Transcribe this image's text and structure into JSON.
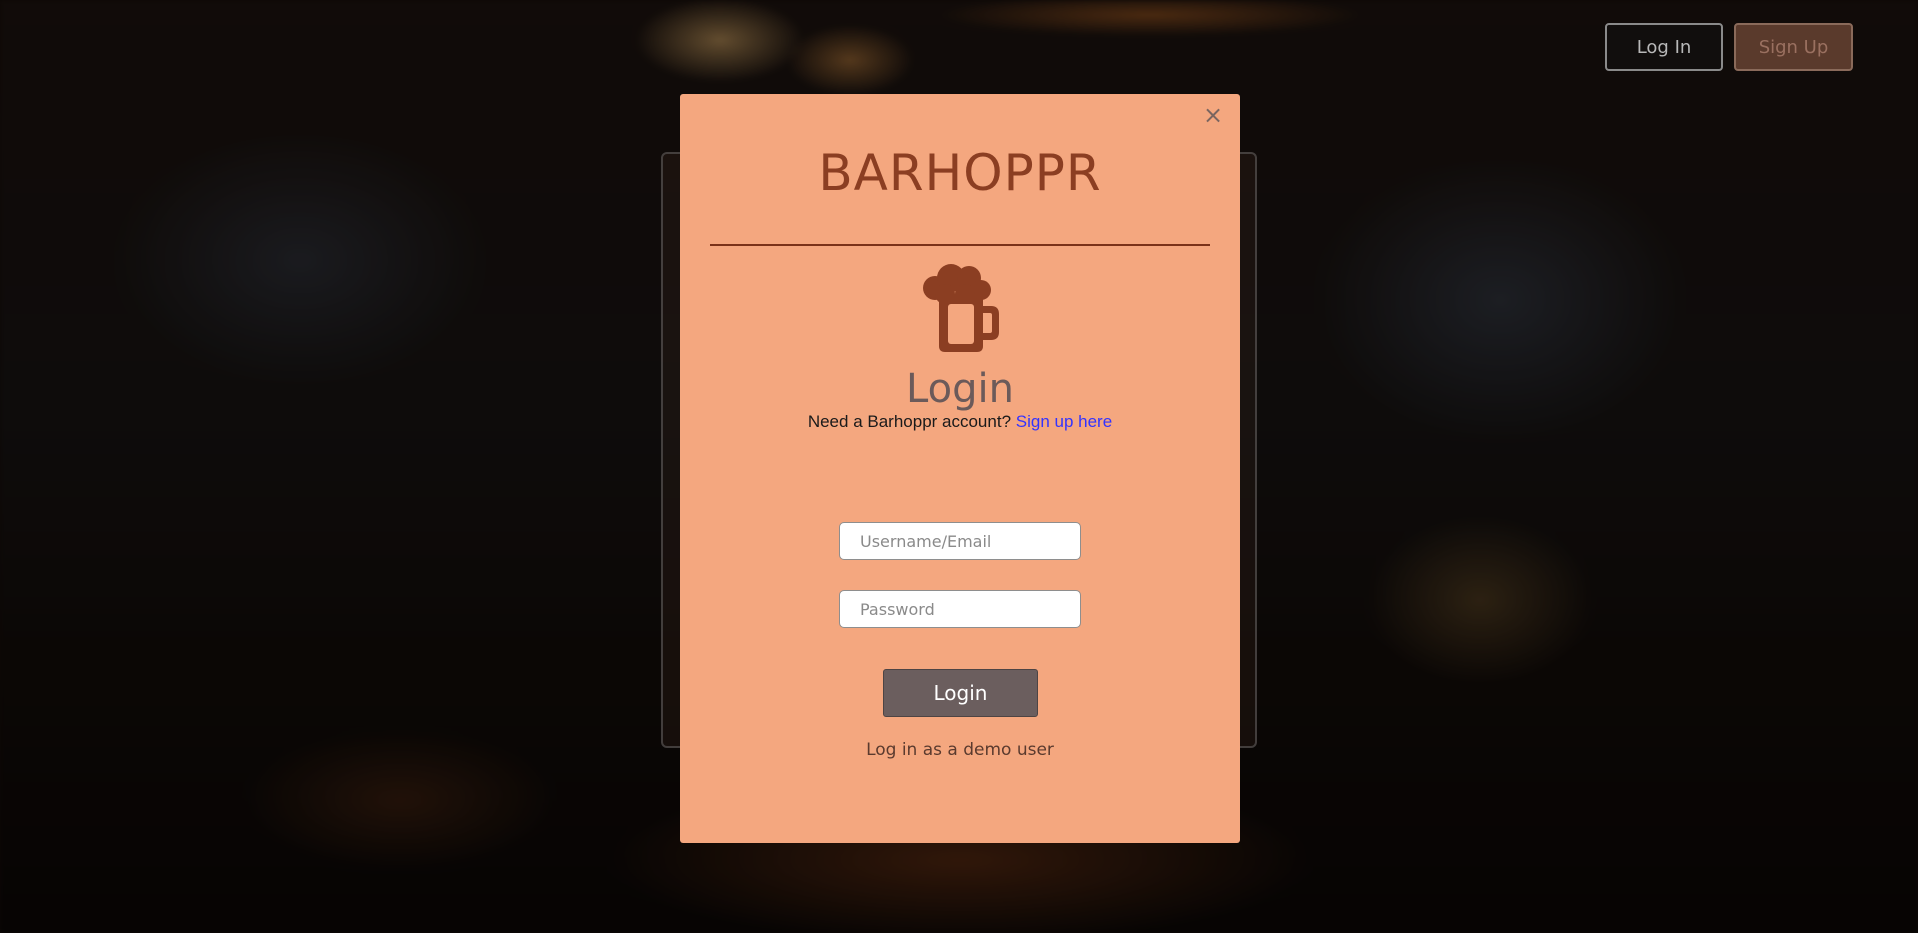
{
  "nav": {
    "login_label": "Log In",
    "signup_label": "Sign Up"
  },
  "modal": {
    "close_symbol": "×",
    "brand": "BARHOPPR",
    "icon": "beer-mug-icon",
    "title": "Login",
    "prompt_text": "Need a Barhoppr account?",
    "signup_link": "Sign up here",
    "username_placeholder": "Username/Email",
    "username_value": "",
    "password_placeholder": "Password",
    "password_value": "",
    "submit_label": "Login",
    "demo_label": "Log in as a demo user"
  },
  "colors": {
    "modal_bg": "#f4a77f",
    "brand": "#8b3e22",
    "button_bg": "#6b5e5e",
    "link": "#3333ff"
  }
}
